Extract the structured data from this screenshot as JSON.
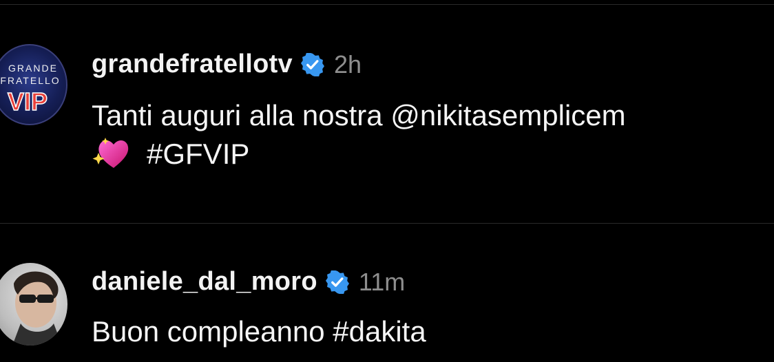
{
  "colors": {
    "background": "#000000",
    "verified_badge": "#3897f0",
    "timestamp": "#8e8e8e",
    "divider": "#2a2a2a"
  },
  "posts": [
    {
      "avatar_icon": "grande-fratello-vip-logo-icon",
      "avatar_lines": [
        "GRANDE",
        "FRATELLO",
        "VIP"
      ],
      "username": "grandefratellotv",
      "verified": true,
      "time": "2h",
      "text_line1": "Tanti auguri alla nostra @nikitasemplicem",
      "emoji": "sparkling-heart",
      "text_line2": "#GFVIP"
    },
    {
      "avatar_icon": "profile-photo-avatar",
      "username": "daniele_dal_moro",
      "verified": true,
      "time": "11m",
      "text_line1": "Buon compleanno #dakita"
    }
  ]
}
